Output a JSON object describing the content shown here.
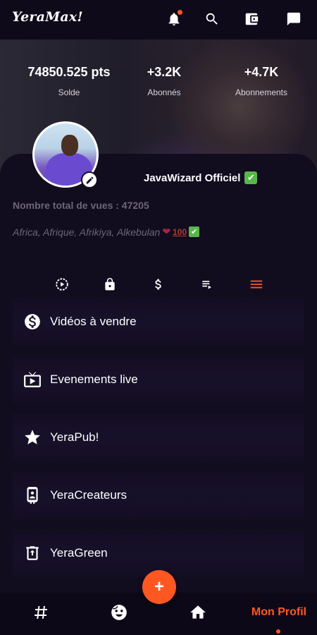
{
  "app": {
    "logo": "YeraMax!"
  },
  "header_icons": [
    "notification-bell-icon",
    "search-icon",
    "wallet-icon",
    "chat-icon"
  ],
  "stats": [
    {
      "value": "74850.525 pts",
      "label": "Solde"
    },
    {
      "value": "+3.2K",
      "label": "Abonnés"
    },
    {
      "value": "+4.7K",
      "label": "Abonnements"
    }
  ],
  "profile": {
    "username": "JavaWizard Officiel",
    "verified_badge": "✔",
    "views_text": "Nombre total de vues : 47205",
    "bio_text": "Africa, Afrique, Afrikiya, Alkebulan",
    "bio_heart": "❤",
    "bio_hundred": "100",
    "bio_check": "✔"
  },
  "tabs": [
    {
      "icon": "play-history-icon"
    },
    {
      "icon": "lock-icon"
    },
    {
      "icon": "dollar-icon"
    },
    {
      "icon": "playlist-icon"
    },
    {
      "icon": "menu-icon",
      "active": true
    }
  ],
  "menu": [
    {
      "label": "Vidéos à vendre",
      "icon": "dollar-circle-icon"
    },
    {
      "label": "Evenements live",
      "icon": "live-tv-icon"
    },
    {
      "label": "YeraPub!",
      "icon": "star-icon"
    },
    {
      "label": "YeraCreateurs",
      "icon": "phone-creator-icon"
    },
    {
      "label": "YeraGreen",
      "icon": "recycle-bin-icon"
    }
  ],
  "bottom_nav": {
    "fab_label": "+",
    "active_label": "Mon Profil",
    "items": [
      "hashtag-icon",
      "emoji-icon",
      "home-icon"
    ]
  },
  "colors": {
    "accent": "#ff5722",
    "background": "#0f0a1a",
    "verified": "#57b84a"
  }
}
